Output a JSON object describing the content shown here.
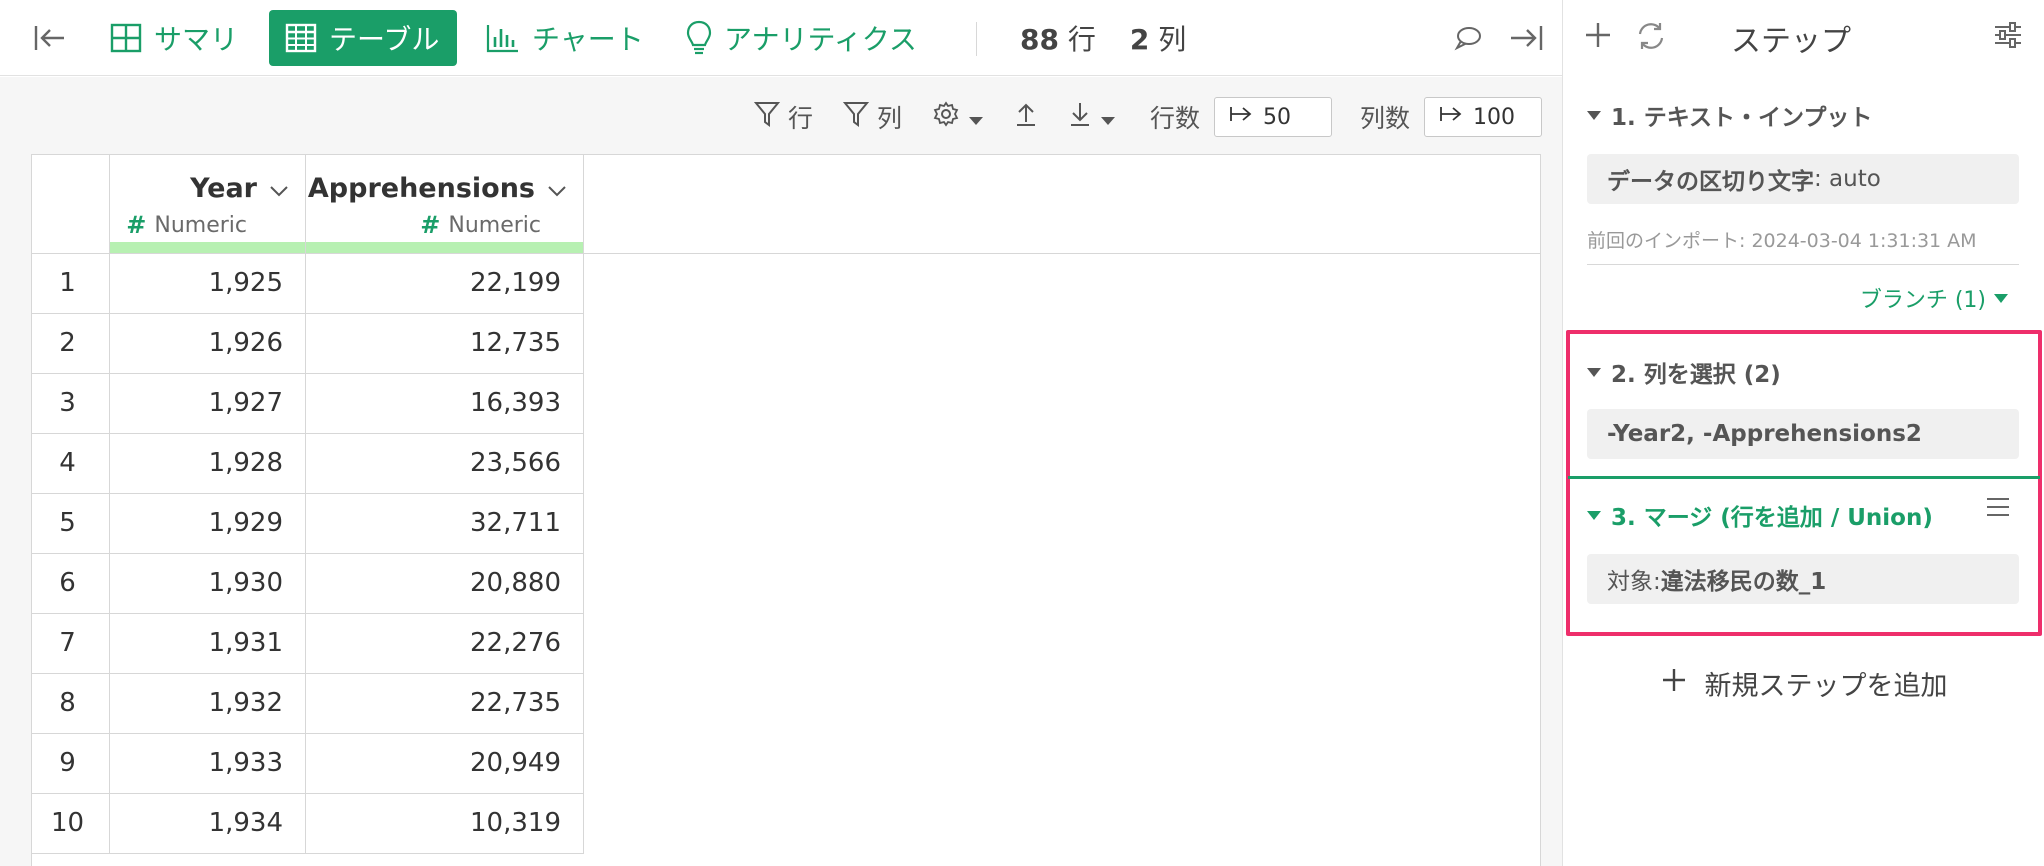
{
  "topbar": {
    "tabs": [
      {
        "label": "サマリ",
        "icon": "summary-grid-icon"
      },
      {
        "label": "テーブル",
        "icon": "table-icon",
        "active": true
      },
      {
        "label": "チャート",
        "icon": "bar-chart-icon"
      },
      {
        "label": "アナリティクス",
        "icon": "lightbulb-icon"
      }
    ],
    "row_count": "88",
    "row_unit": "行",
    "col_count": "2",
    "col_unit": "列"
  },
  "toolbar": {
    "filter_rows_label": "行",
    "filter_cols_label": "列",
    "rows_label": "行数",
    "rows_value": "50",
    "cols_label": "列数",
    "cols_value": "100"
  },
  "table": {
    "columns": [
      {
        "name": "Year",
        "type": "Numeric"
      },
      {
        "name": "Apprehensions",
        "type": "Numeric"
      }
    ],
    "rows": [
      {
        "n": "1",
        "year": "1,925",
        "apprehensions": "22,199"
      },
      {
        "n": "2",
        "year": "1,926",
        "apprehensions": "12,735"
      },
      {
        "n": "3",
        "year": "1,927",
        "apprehensions": "16,393"
      },
      {
        "n": "4",
        "year": "1,928",
        "apprehensions": "23,566"
      },
      {
        "n": "5",
        "year": "1,929",
        "apprehensions": "32,711"
      },
      {
        "n": "6",
        "year": "1,930",
        "apprehensions": "20,880"
      },
      {
        "n": "7",
        "year": "1,931",
        "apprehensions": "22,276"
      },
      {
        "n": "8",
        "year": "1,932",
        "apprehensions": "22,735"
      },
      {
        "n": "9",
        "year": "1,933",
        "apprehensions": "20,949"
      },
      {
        "n": "10",
        "year": "1,934",
        "apprehensions": "10,319"
      }
    ]
  },
  "panel": {
    "title": "ステップ",
    "steps": [
      {
        "title": "1. テキスト・インプット",
        "box_label": "データの区切り文字",
        "box_value": ": auto",
        "meta": "前回のインポート: 2024-03-04 1:31:31 AM"
      },
      {
        "title": "2. 列を選択 (2)",
        "box_value": "-Year2, -Apprehensions2"
      },
      {
        "title": "3. マージ (行を追加 / Union)",
        "box_label": "対象: ",
        "box_value": "違法移民の数_1"
      }
    ],
    "branch_label": "ブランチ (1)",
    "add_step_label": "新規ステップを追加"
  },
  "colors": {
    "accent": "#1a9e68",
    "highlight": "#ee2e6b",
    "numeric_bar": "#b7f0b2"
  }
}
